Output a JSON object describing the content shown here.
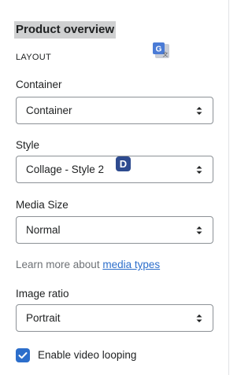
{
  "panel": {
    "title": "Product overview",
    "section_heading": "LAYOUT",
    "translate_icon": "translate-icon",
    "badge_d": "D"
  },
  "fields": {
    "container": {
      "label": "Container",
      "value": "Container"
    },
    "style": {
      "label": "Style",
      "value": "Collage - Style 2"
    },
    "media_size": {
      "label": "Media Size",
      "value": "Normal"
    },
    "image_ratio": {
      "label": "Image ratio",
      "value": "Portrait"
    }
  },
  "help": {
    "prefix": "Learn more about ",
    "link": "media types"
  },
  "video_looping": {
    "label": "Enable video looping",
    "checked": true
  },
  "colors": {
    "accent": "#2c6ecb",
    "title_highlight": "#cfd0d1",
    "badge": "#2e4b8f"
  }
}
